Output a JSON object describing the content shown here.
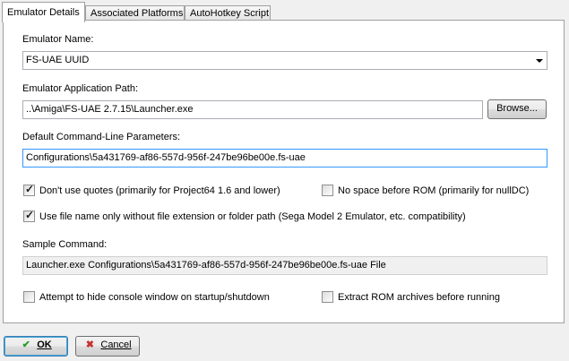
{
  "tabs": [
    "Emulator Details",
    "Associated Platforms",
    "AutoHotkey Script"
  ],
  "emulator_name": {
    "label": "Emulator Name:",
    "value": "FS-UAE UUID"
  },
  "app_path": {
    "label": "Emulator Application Path:",
    "value": "..\\Amiga\\FS-UAE 2.7.15\\Launcher.exe",
    "browse_label": "Browse..."
  },
  "cmd_params": {
    "label": "Default Command-Line Parameters:",
    "value": "Configurations\\5a431769-af86-557d-956f-247be96be00e.fs-uae"
  },
  "options": {
    "no_quotes": {
      "label": "Don't use quotes (primarily for Project64 1.6 and lower)",
      "checked": true
    },
    "no_space": {
      "label": "No space before ROM (primarily for nullDC)",
      "checked": false
    },
    "filename_only": {
      "label": "Use file name only without file extension or folder path (Sega Model 2 Emulator, etc. compatibility)",
      "checked": true
    },
    "hide_console": {
      "label": "Attempt to hide console window on startup/shutdown",
      "checked": false
    },
    "extract_rom": {
      "label": "Extract ROM archives before running",
      "checked": false
    }
  },
  "sample": {
    "label": "Sample Command:",
    "value": "Launcher.exe Configurations\\5a431769-af86-557d-956f-247be96be00e.fs-uae File"
  },
  "footer": {
    "ok_label": "OK",
    "ok_icon": "checkmark-icon",
    "ok_icon_color": "#2a9d2a",
    "cancel_label": "Cancel",
    "cancel_icon": "x-icon",
    "cancel_icon_color": "#c83232"
  }
}
